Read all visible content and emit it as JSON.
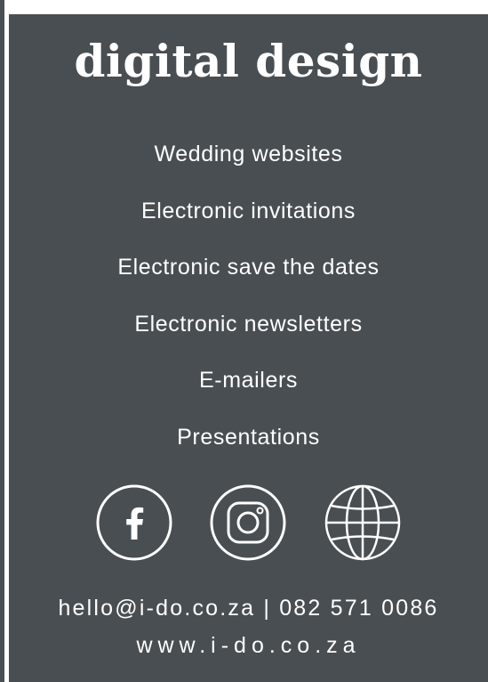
{
  "title": "digital design",
  "services": [
    "Wedding websites",
    "Electronic invitations",
    "Electronic save the dates",
    "Electronic newsletters",
    "E-mailers",
    "Presentations"
  ],
  "social_icons": [
    "facebook-icon",
    "instagram-icon",
    "globe-icon"
  ],
  "contact": {
    "line": "hello@i-do.co.za | 082 571 0086",
    "website": "www.i-do.co.za"
  },
  "colors": {
    "panel": "#494e52",
    "text": "#ffffff"
  }
}
